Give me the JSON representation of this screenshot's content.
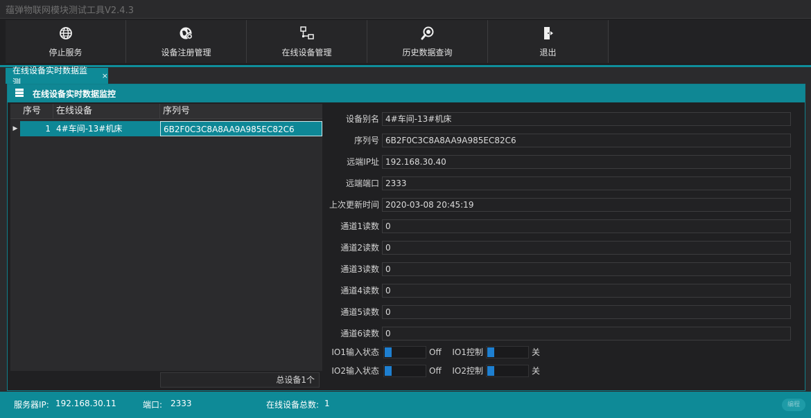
{
  "app": {
    "title": "蕴弹物联网模块测试工具V2.4.3"
  },
  "toolbar": {
    "buttons": [
      {
        "label": "停止服务",
        "icon": "globe-icon"
      },
      {
        "label": "设备注册管理",
        "icon": "globe-gear-icon"
      },
      {
        "label": "在线设备管理",
        "icon": "network-icon"
      },
      {
        "label": "历史数据查询",
        "icon": "magnifier-icon"
      },
      {
        "label": "退出",
        "icon": "exit-door-icon"
      }
    ]
  },
  "tabs": [
    {
      "label": "在线设备实时数据监测",
      "close": "×"
    }
  ],
  "panel": {
    "title": "在线设备实时数据监控",
    "icon": "server-icon"
  },
  "grid": {
    "columns": [
      "序号",
      "在线设备",
      "序列号"
    ],
    "rows": [
      {
        "index": "1",
        "device": "4#车间-13#机床",
        "serial": "6B2F0C3C8A8AA9A985EC82C6"
      }
    ],
    "total_label": "总设备1个"
  },
  "details": {
    "fields": [
      {
        "label": "设备别名",
        "value": "4#车间-13#机床"
      },
      {
        "label": "序列号",
        "value": "6B2F0C3C8A8AA9A985EC82C6"
      },
      {
        "label": "远端IP址",
        "value": "192.168.30.40"
      },
      {
        "label": "远端端口",
        "value": "2333"
      },
      {
        "label": "上次更新时间",
        "value": "2020-03-08 20:45:19"
      },
      {
        "label": "通道1读数",
        "value": "0"
      },
      {
        "label": "通道2读数",
        "value": "0"
      },
      {
        "label": "通道3读数",
        "value": "0"
      },
      {
        "label": "通道4读数",
        "value": "0"
      },
      {
        "label": "通道5读数",
        "value": "0"
      },
      {
        "label": "通道6读数",
        "value": "0"
      }
    ],
    "io": [
      {
        "input_label": "IO1输入状态",
        "input_state": "Off",
        "control_label": "IO1控制",
        "control_state": "关"
      },
      {
        "input_label": "IO2输入状态",
        "input_state": "Off",
        "control_label": "IO2控制",
        "control_state": "关"
      }
    ]
  },
  "status": {
    "server_ip_label": "服务器IP:",
    "server_ip": "192.168.30.11",
    "port_label": "端口:",
    "port": "2333",
    "online_label": "在线设备总数:",
    "online_count": "1",
    "stamp": "编程"
  },
  "colors": {
    "accent": "#0e8a97",
    "toggle_knob": "#1e7fd0",
    "background": "#2b2b2d"
  }
}
